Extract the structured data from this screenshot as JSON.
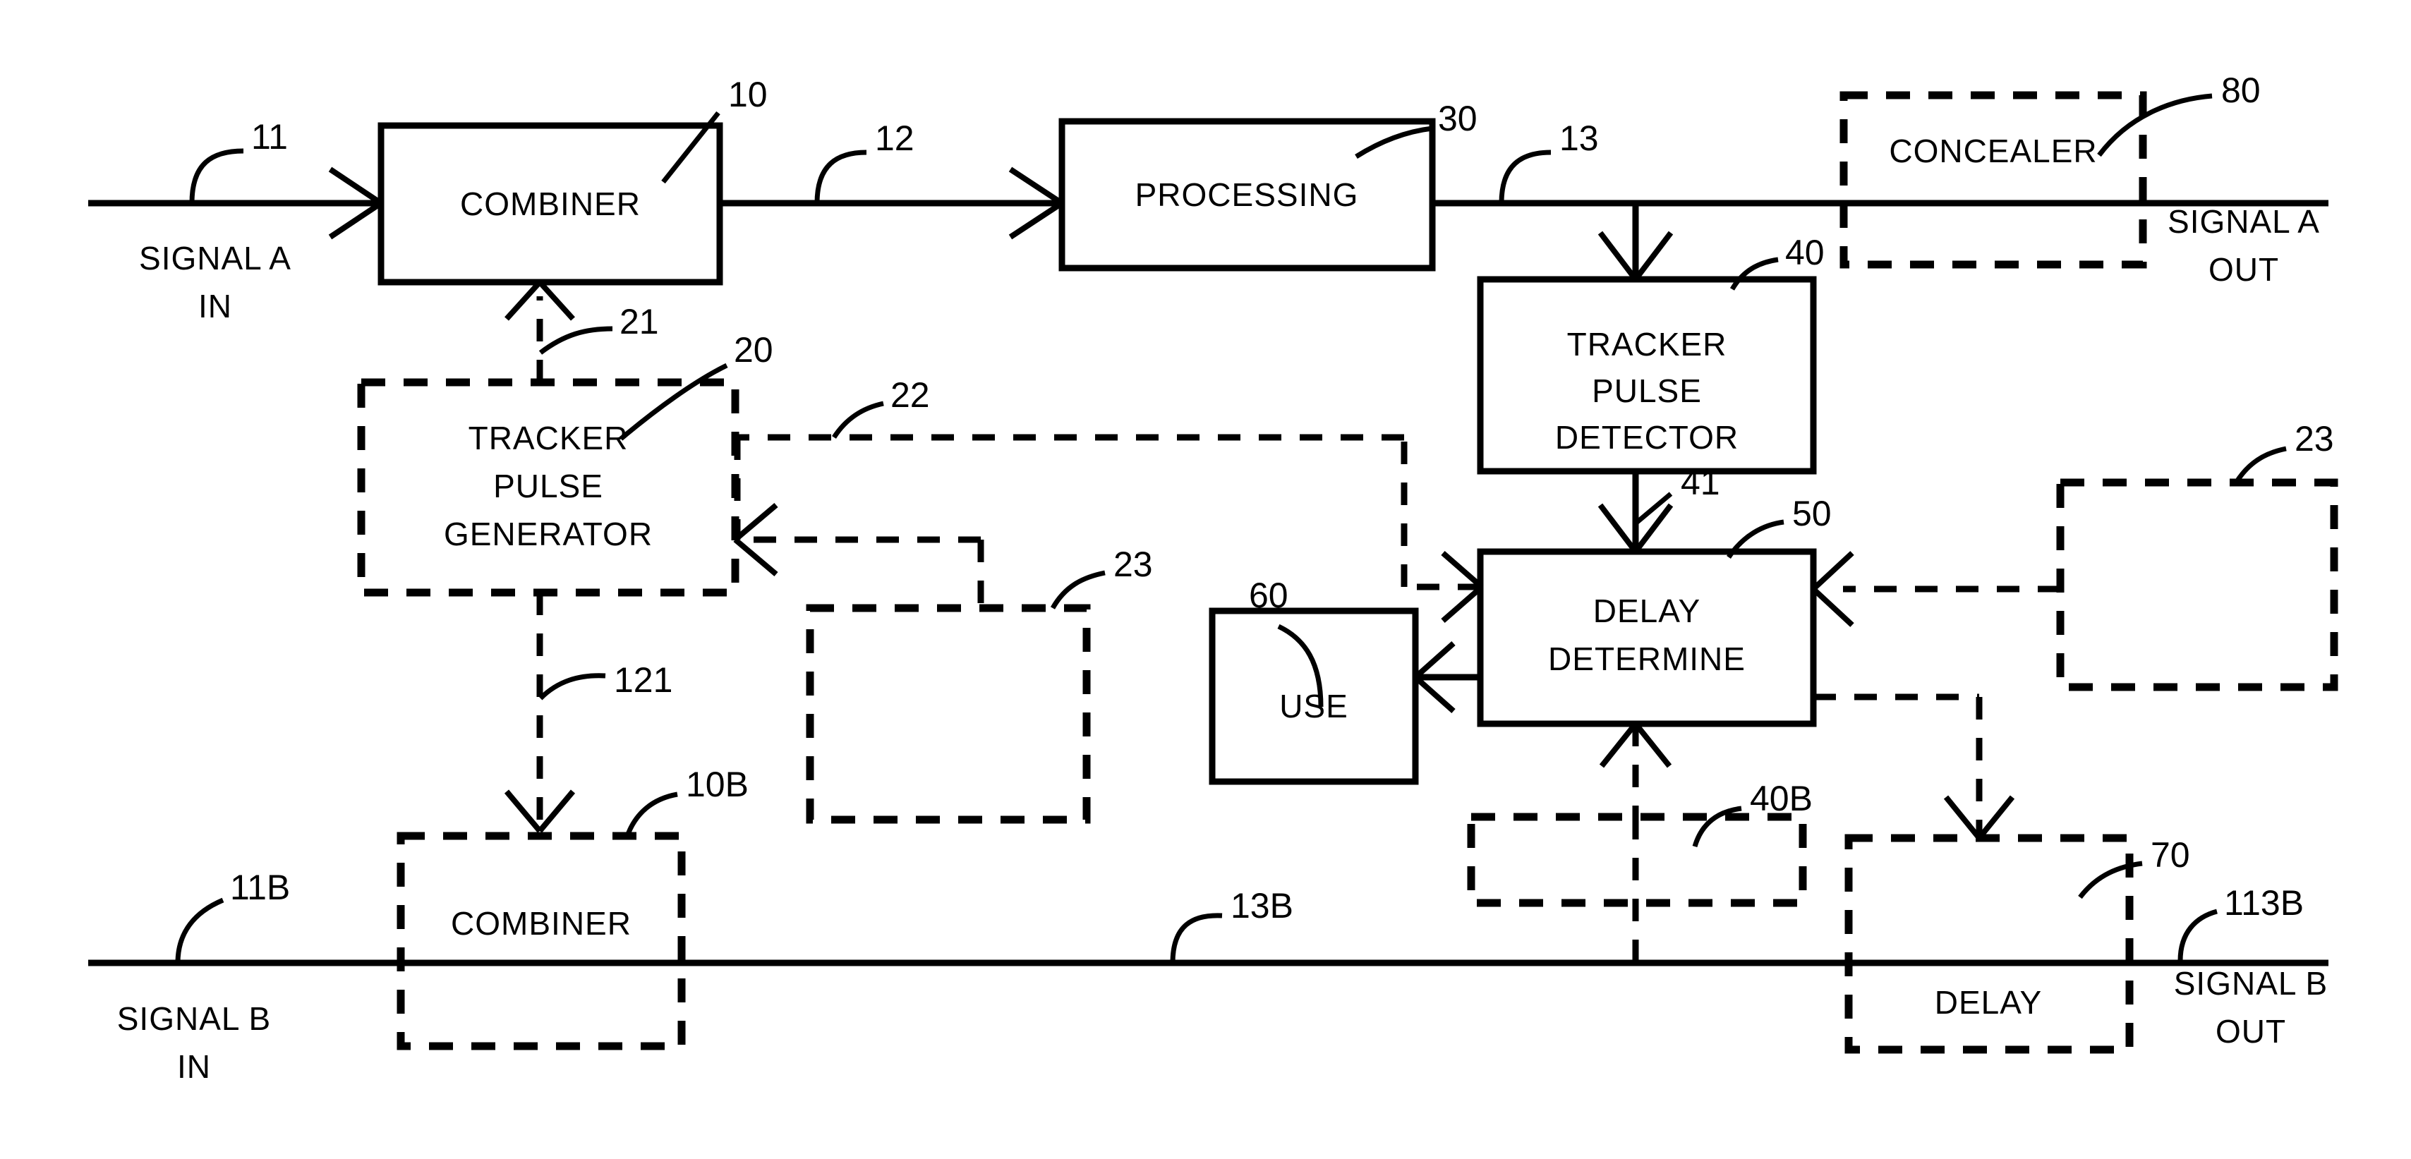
{
  "figure": {
    "type": "patent-block-diagram",
    "blocks": [
      {
        "id": "combiner-a",
        "label": "COMBINER",
        "ref": "10",
        "style": "solid"
      },
      {
        "id": "processing",
        "label": "PROCESSING",
        "ref": "30",
        "style": "solid"
      },
      {
        "id": "concealer",
        "label": "CONCEALER",
        "ref": "80",
        "style": "dashed"
      },
      {
        "id": "tracker-pulse-detector",
        "label": "TRACKER PULSE DETECTOR",
        "label_lines": [
          "TRACKER",
          "PULSE",
          "DETECTOR"
        ],
        "ref": "40",
        "style": "solid"
      },
      {
        "id": "tracker-pulse-generator",
        "label": "TRACKER PULSE GENERATOR",
        "label_lines": [
          "TRACKER",
          "PULSE",
          "GENERATOR"
        ],
        "ref": "20",
        "style": "dashed"
      },
      {
        "id": "delay-determine",
        "label": "DELAY DETERMINE",
        "label_lines": [
          "DELAY",
          "DETERMINE"
        ],
        "ref": "50",
        "style": "solid"
      },
      {
        "id": "use",
        "label": "USE",
        "ref": "60",
        "style": "solid"
      },
      {
        "id": "combiner-b",
        "label": "COMBINER",
        "ref": "10B",
        "style": "dashed"
      },
      {
        "id": "delay-b",
        "label": "DELAY",
        "ref": "70",
        "style": "dashed"
      },
      {
        "id": "optional-left",
        "label": "",
        "ref": "23",
        "style": "dashed"
      },
      {
        "id": "optional-right",
        "label": "",
        "ref": "23",
        "style": "dashed"
      },
      {
        "id": "optional-detector-b",
        "label": "",
        "ref": "40B",
        "style": "dashed"
      }
    ],
    "signal_labels": [
      {
        "id": "signal-a-in",
        "lines": [
          "SIGNAL A",
          "IN"
        ]
      },
      {
        "id": "signal-a-out",
        "lines": [
          "SIGNAL A",
          "OUT"
        ]
      },
      {
        "id": "signal-b-in",
        "lines": [
          "SIGNAL B",
          "IN"
        ]
      },
      {
        "id": "signal-b-out",
        "lines": [
          "SIGNAL B",
          "OUT"
        ]
      }
    ],
    "reference_numerals": [
      {
        "id": "ref-11",
        "text": "11"
      },
      {
        "id": "ref-10",
        "text": "10"
      },
      {
        "id": "ref-12",
        "text": "12"
      },
      {
        "id": "ref-30",
        "text": "30"
      },
      {
        "id": "ref-13",
        "text": "13"
      },
      {
        "id": "ref-80",
        "text": "80"
      },
      {
        "id": "ref-40",
        "text": "40"
      },
      {
        "id": "ref-21",
        "text": "21"
      },
      {
        "id": "ref-20",
        "text": "20"
      },
      {
        "id": "ref-22",
        "text": "22"
      },
      {
        "id": "ref-23a",
        "text": "23"
      },
      {
        "id": "ref-23b",
        "text": "23"
      },
      {
        "id": "ref-41",
        "text": "41"
      },
      {
        "id": "ref-50",
        "text": "50"
      },
      {
        "id": "ref-60",
        "text": "60"
      },
      {
        "id": "ref-121",
        "text": "121"
      },
      {
        "id": "ref-10b",
        "text": "10B"
      },
      {
        "id": "ref-40b",
        "text": "40B"
      },
      {
        "id": "ref-11b",
        "text": "11B"
      },
      {
        "id": "ref-13b",
        "text": "13B"
      },
      {
        "id": "ref-70",
        "text": "70"
      },
      {
        "id": "ref-113b",
        "text": "113B"
      }
    ],
    "colors": {
      "ink": "#000000",
      "paper": "#ffffff"
    }
  }
}
